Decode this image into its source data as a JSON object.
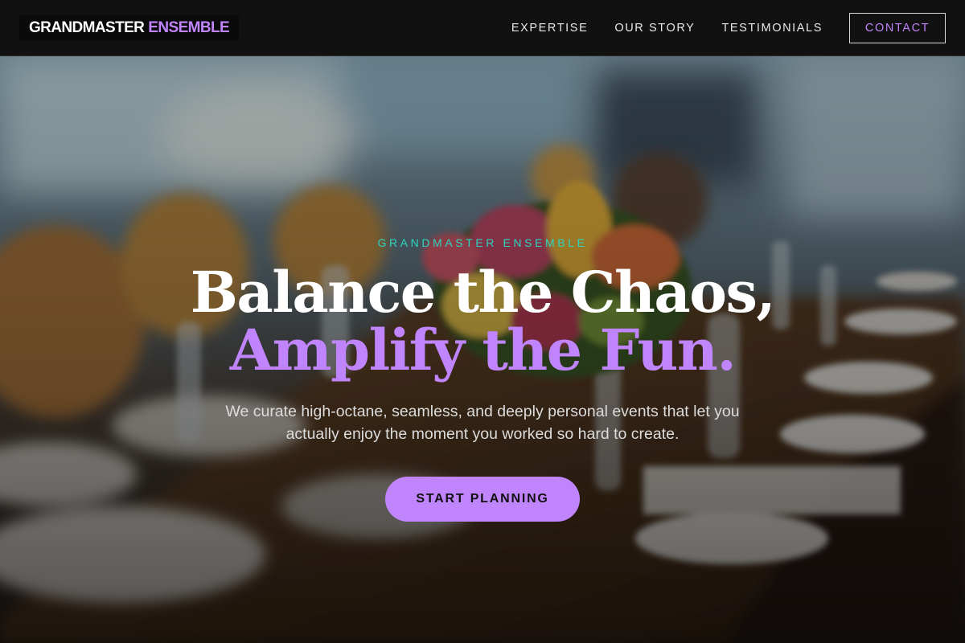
{
  "brand": {
    "word1": "GRANDMASTER",
    "word2": "ENSEMBLE"
  },
  "nav": {
    "links": [
      "EXPERTISE",
      "OUR STORY",
      "TESTIMONIALS"
    ],
    "cta_label": "CONTACT"
  },
  "hero": {
    "eyebrow": "GRANDMASTER ENSEMBLE",
    "headline_line1": "Balance the Chaos,",
    "headline_line2": "Amplify the Fun.",
    "subtitle": "We curate high-octane, seamless, and deeply personal events that let you actually enjoy the moment you worked so hard to create.",
    "cta_label": "START PLANNING",
    "background_image": "blurred-banquet-table-image"
  },
  "colors": {
    "accent": "#c084fc",
    "teal": "#2dd4bf",
    "nav_bg": "#111111"
  }
}
